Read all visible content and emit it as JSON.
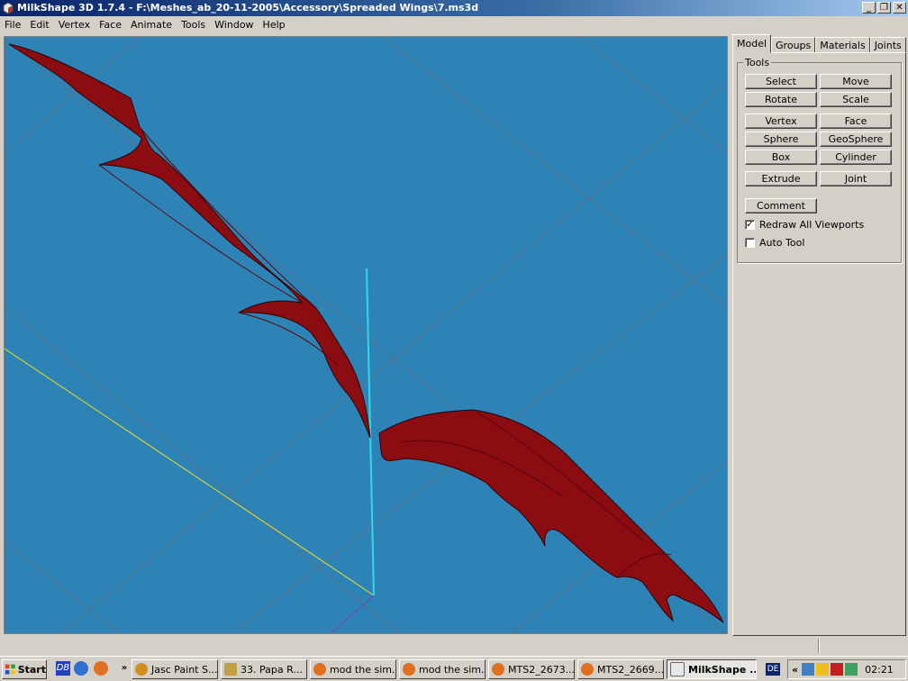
{
  "window": {
    "title": "MilkShape 3D 1.7.4 - F:\\Meshes_ab_20-11-2005\\Accessory\\Spreaded Wings\\7.ms3d",
    "minimize": "_",
    "restore": "❐",
    "close": "✕"
  },
  "menu": {
    "file": "File",
    "edit": "Edit",
    "vertex": "Vertex",
    "face": "Face",
    "animate": "Animate",
    "tools": "Tools",
    "window": "Window",
    "help": "Help"
  },
  "tabs": [
    "Model",
    "Groups",
    "Materials",
    "Joints"
  ],
  "tools_group": {
    "label": "Tools",
    "buttons": [
      "Select",
      "Move",
      "Rotate",
      "Scale",
      "Vertex",
      "Face",
      "Sphere",
      "GeoSphere",
      "Box",
      "Cylinder",
      "Extrude",
      "Joint",
      "Comment"
    ],
    "redraw_label": "Redraw All Viewports",
    "redraw_checked": true,
    "auto_tool_label": "Auto Tool",
    "auto_tool_checked": false
  },
  "viewport": {
    "background": "#2d83b6",
    "mesh_color": "#8b0d12",
    "axis_color": "#35d6e8",
    "grid_line_color": "#f0e020"
  },
  "taskbar": {
    "start": "Start",
    "more": "»",
    "items": [
      "Jasc Paint S...",
      "33. Papa R...",
      "mod the sim...",
      "mod the sim...",
      "MTS2_2673...",
      "MTS2_2669...",
      "MilkShape ..."
    ],
    "lang": "DE",
    "tray_more": "«",
    "clock": "02:21"
  }
}
